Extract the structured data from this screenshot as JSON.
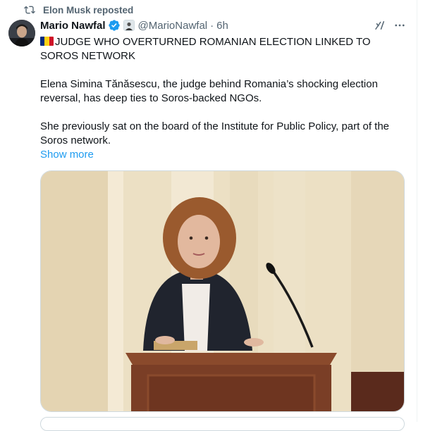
{
  "repost": {
    "icon": "repost-icon",
    "label": "Elon Musk reposted"
  },
  "tweet": {
    "author_name": "Mario Nawfal",
    "handle": "@MarioNawfal",
    "separator": "·",
    "time": "6h",
    "headline": "JUDGE WHO OVERTURNED ROMANIAN ELECTION LINKED TO SOROS NETWORK",
    "paragraph_1": "Elena Simina Tănăsescu, the judge behind Romania’s shocking election reversal, has deep ties to Soros-backed NGOs.",
    "paragraph_2": "She previously sat on the board of the Institute for Public Policy, part of the Soros network.",
    "show_more": "Show more"
  },
  "colors": {
    "link": "#1d9bf0",
    "muted": "#536471",
    "verified": "#1d9bf0",
    "flag": [
      "#002b7f",
      "#fcd116",
      "#ce1126"
    ]
  },
  "icons": [
    "repost-icon",
    "verified-badge-icon",
    "affiliate-badge-icon",
    "grok-icon",
    "more-options-icon",
    "romania-flag-icon"
  ]
}
